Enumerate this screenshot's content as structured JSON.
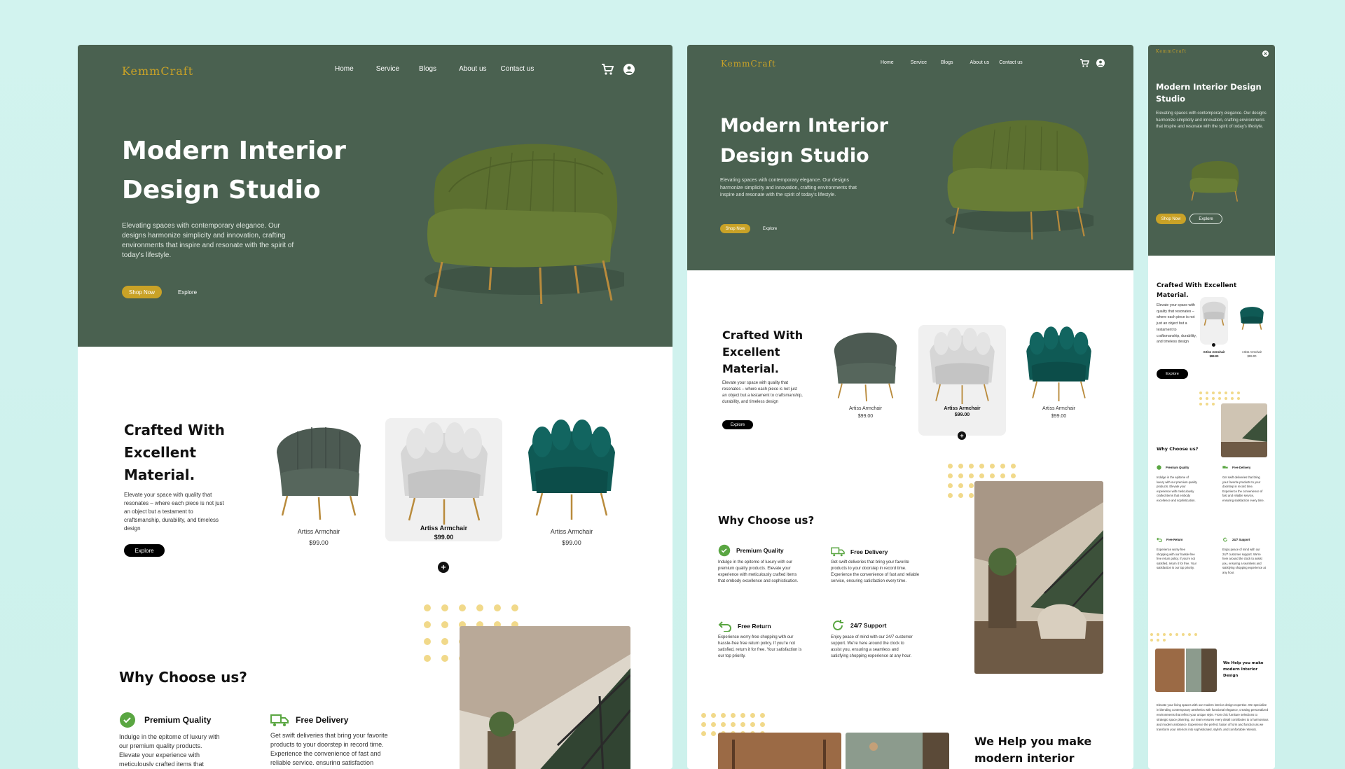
{
  "brand": {
    "logo": "KemmCraft",
    "accent": "#c9a227",
    "hero_bg": "#4a6150"
  },
  "nav": {
    "home": "Home",
    "service": "Service",
    "blogs": "Blogs",
    "about": "About us",
    "contact": "Contact us"
  },
  "icons": {
    "cart": "cart-icon",
    "user": "user-icon",
    "close": "close-icon"
  },
  "hero": {
    "title_line1": "Modern Interior",
    "title_line2": "Design Studio",
    "title_mobile": "Modern Interior Design Studio",
    "description": "Elevating spaces with contemporary elegance. Our designs harmonize simplicity and innovation, crafting environments that inspire and resonate with the spirit of today's lifestyle.",
    "shop_label": "Shop Now",
    "explore_label": "Explore"
  },
  "products": {
    "title_line1": "Crafted With",
    "title_line2": "Excellent",
    "title_line3": "Material.",
    "title_mobile": "Crafted With Excellent Material.",
    "description": "Elevate your space with quality that resonates – where each piece is not just an object but a testament to craftsmanship, durability, and timeless design",
    "explore_label": "Explore",
    "items": [
      {
        "name": "Artiss Armchair",
        "price": "$99.00",
        "color": "#4c5a52"
      },
      {
        "name": "Artiss Armchair",
        "price": "$99.00",
        "color": "#cfcfcf"
      },
      {
        "name": "Artiss Armchair",
        "price": "$99.00",
        "color": "#0f5a55"
      }
    ]
  },
  "why": {
    "title": "Why Choose us?",
    "features": [
      {
        "title": "Premium Quality",
        "text": "Indulge in the epitome of luxury with our premium quality products. Elevate your experience with meticulously crafted items that embody excellence and sophistication.",
        "icon": "badge-check-icon"
      },
      {
        "title": "Free Delivery",
        "text": "Get swift deliveries that bring your favorite products to your doorstep in record time. Experience the convenience of fast and reliable service, ensuring satisfaction every time.",
        "icon": "truck-icon"
      },
      {
        "title": "Free Return",
        "text": "Experience worry-free shopping with our hassle-free free return policy. If you're not satisfied, return it for free. Your satisfaction is our top priority.",
        "icon": "return-icon"
      },
      {
        "title": "24/7 Support",
        "text": "Enjoy peace of mind with our 24/7 customer support. We're here around the clock to assist you, ensuring a seamless and satisfying shopping experience at any hour.",
        "icon": "support-icon"
      }
    ]
  },
  "help": {
    "title_line1": "We Help you make",
    "title_line2": "modern interior",
    "title_mobile": "We Help you make modern Interior Design",
    "text": "Elevate your living spaces with our modern interior design expertise. We specialize in blending contemporary aesthetics with functional elegance, creating personalized environments that reflect your unique style. From chic furniture selections to strategic space planning, our team ensures every detail contributes to a harmonious and modern ambiance. Experience the perfect fusion of form and function as we transform your interiors into sophisticated, stylish, and comfortable retreats."
  }
}
